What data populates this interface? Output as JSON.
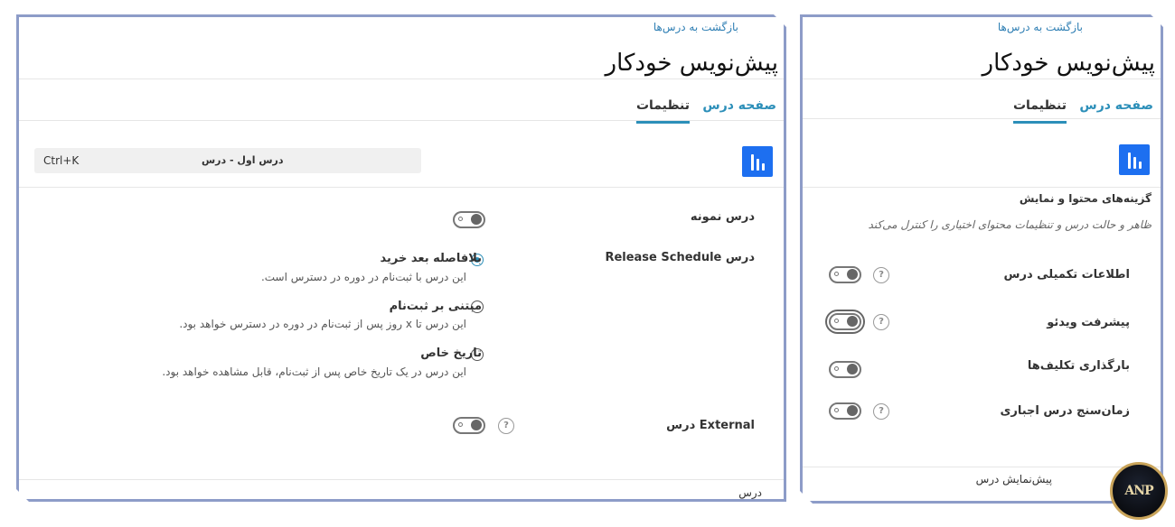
{
  "left": {
    "back_link": "بازگشت به درس‌ها",
    "title": "پیش‌نویس خودکار",
    "tabs": [
      {
        "label": "صفحه درس",
        "active": false
      },
      {
        "label": "تنظیمات",
        "active": true
      }
    ],
    "search": {
      "shortcut": "Ctrl+K",
      "value": "درس اول - درس"
    },
    "sample_lesson": {
      "label": "درس نمونه"
    },
    "release_schedule": {
      "label": "درس Release Schedule",
      "options": [
        {
          "label": "بلافاصله بعد خرید",
          "desc": "این درس با ثبت‌نام در دوره در دسترس است.",
          "checked": true
        },
        {
          "label": "مبتنی بر ثبت‌نام",
          "desc": "این درس تا x روز پس از ثبت‌نام در دوره در دسترس خواهد بود.",
          "checked": false
        },
        {
          "label": "تاریخ خاص",
          "desc": "این درس در یک تاریخ خاص پس از ثبت‌نام، قابل مشاهده خواهد بود.",
          "checked": false
        }
      ]
    },
    "external": {
      "label": "External درس"
    },
    "footer_label": "درس"
  },
  "right": {
    "back_link": "بازگشت به درس‌ها",
    "title": "پیش‌نویس خودکار",
    "tabs": [
      {
        "label": "صفحه درس",
        "active": false
      },
      {
        "label": "تنظیمات",
        "active": true
      }
    ],
    "section": {
      "title": "گزینه‌های محتوا و نمایش",
      "subtitle": "ظاهر و حالت درس و تنظیمات محتوای اختیاری را کنترل می‌کند"
    },
    "settings": [
      {
        "label": "اطلاعات تکمیلی درس",
        "help": true
      },
      {
        "label": "پیشرفت ویدئو",
        "help": true
      },
      {
        "label": "بارگذاری تکلیف‌ها",
        "help": false
      },
      {
        "label": "زمان‌سنج درس اجباری",
        "help": true
      }
    ],
    "footer_label": "پیش‌نمایش درس"
  },
  "badge": {
    "text": "ANP"
  },
  "colors": {
    "accent": "#2c8fb9",
    "chart_button": "#1d6ff0",
    "panel_border": "#8d9cc8"
  }
}
